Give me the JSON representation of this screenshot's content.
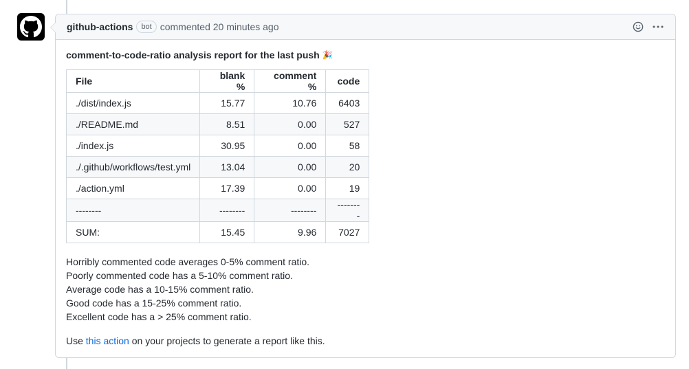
{
  "comment": {
    "author": "github-actions",
    "badge": "bot",
    "meta": "commented 20 minutes ago",
    "icons": {
      "avatar": "github-octocat-icon",
      "reaction": "smiley-icon",
      "menu": "kebab-horizontal-icon"
    }
  },
  "report": {
    "title": "comment-to-code-ratio analysis report for the last push",
    "title_emoji": "🎉",
    "table": {
      "headers": [
        "File",
        "blank %",
        "comment %",
        "code"
      ],
      "rows": [
        [
          "./dist/index.js",
          "15.77",
          "10.76",
          "6403"
        ],
        [
          "./README.md",
          "8.51",
          "0.00",
          "527"
        ],
        [
          "./index.js",
          "30.95",
          "0.00",
          "58"
        ],
        [
          "./.github/workflows/test.yml",
          "13.04",
          "0.00",
          "20"
        ],
        [
          "./action.yml",
          "17.39",
          "0.00",
          "19"
        ],
        [
          "--------",
          "--------",
          "--------",
          "--------"
        ],
        [
          "SUM:",
          "15.45",
          "9.96",
          "7027"
        ]
      ]
    },
    "notes": [
      "Horribly commented code averages 0-5% comment ratio.",
      "Poorly commented code has a 5-10% comment ratio.",
      "Average code has a 10-15% comment ratio.",
      "Good code has a 15-25% comment ratio.",
      "Excellent code has a > 25% comment ratio."
    ],
    "footer": {
      "before": "Use ",
      "link_text": "this action",
      "after": " on your projects to generate a report like this."
    }
  }
}
